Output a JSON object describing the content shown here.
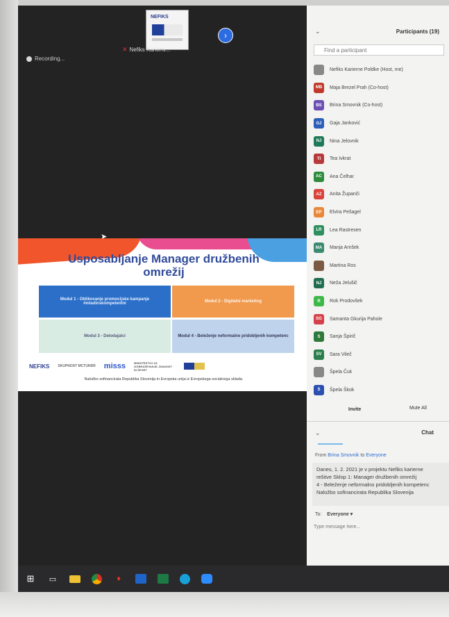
{
  "meeting": {
    "self_name": "Nefiks Karierni...",
    "recording_label": "Recording..."
  },
  "slide": {
    "title": "Usposabljanje Manager družbenih omrežij",
    "modules": [
      "Modul 1 - Oblikovanje promocijske kampanje #mladinskompetentni",
      "Modul 2 - Digitalni marketing",
      "Modul 3 - Delodajalci",
      "Modul 4 - Beleženje neformalno pridobljenih kompetenc"
    ],
    "sponsors": {
      "nefiks": "NEFIKS",
      "skupnost": "SKUPNOST MCTUNDR",
      "misss": "misss",
      "ministry": "MINISTRSTVO ZA IZOBRAŽEVANJE, ZNANOST IN ŠPORT"
    },
    "footer": "Naložbo sofinancirata Republika Slovenija in Evropska unija iz Evropskega socialnega sklada."
  },
  "participants": {
    "title": "Participants (19)",
    "search_placeholder": "Find a participant",
    "items": [
      {
        "initials": "",
        "name": "Nefiks Karierne Poldke (Host, me)",
        "color": "#888888"
      },
      {
        "initials": "MB",
        "name": "Maja Brezel Prah (Co-host)",
        "color": "#c0392b"
      },
      {
        "initials": "BS",
        "name": "Brina Smovnik (Co-host)",
        "color": "#6c4fb3"
      },
      {
        "initials": "GJ",
        "name": "Gaja Janković",
        "color": "#2b5fb8"
      },
      {
        "initials": "NJ",
        "name": "Nina Jelovnik",
        "color": "#1f7a5a"
      },
      {
        "initials": "TI",
        "name": "Tea Ivkrat",
        "color": "#b73a3a"
      },
      {
        "initials": "AC",
        "name": "Ana Čelhar",
        "color": "#2e8b3e"
      },
      {
        "initials": "AZ",
        "name": "Anita Županči",
        "color": "#d9433b"
      },
      {
        "initials": "EP",
        "name": "Elvira Pešagel",
        "color": "#e9883a"
      },
      {
        "initials": "LR",
        "name": "Lea Rastresen",
        "color": "#2f8f5f"
      },
      {
        "initials": "MA",
        "name": "Manja Arnšek",
        "color": "#3c8a70"
      },
      {
        "initials": "",
        "name": "Martina Ros",
        "color": "#7a5a42"
      },
      {
        "initials": "NJ",
        "name": "Neža Jelušič",
        "color": "#1f6e50"
      },
      {
        "initials": "R",
        "name": "Rok Prodovšek",
        "color": "#3fb84a"
      },
      {
        "initials": "SG",
        "name": "Samanta Gkurija Pahole",
        "color": "#d6404a"
      },
      {
        "initials": "S",
        "name": "Sanja Špirič",
        "color": "#2d7a3a"
      },
      {
        "initials": "SV",
        "name": "Sara Vileč",
        "color": "#2a7f4a"
      },
      {
        "initials": "",
        "name": "Špela Čuk",
        "color": "#888888"
      },
      {
        "initials": "S",
        "name": "Špela Škok",
        "color": "#2c4fb0"
      }
    ],
    "invite_label": "Invite",
    "mute_all_label": "Mute All"
  },
  "chat": {
    "title": "Chat",
    "from_prefix": "From",
    "from_name": "Brina Smovnik",
    "to_word": "to",
    "to_target": "Everyone",
    "message_lines": [
      "Danes, 1. 2. 2021 je v projektu Nefiks karierne",
      "rešitve Sklop 1: Manager družbenih omrežij",
      "4 - Beleženje neformalno pridobljenih kompetenc",
      "Naložbo sofinancirata Republika Slovenija"
    ],
    "to_label": "To:",
    "recipient": "Everyone ▾",
    "input_placeholder": "Type message here..."
  }
}
